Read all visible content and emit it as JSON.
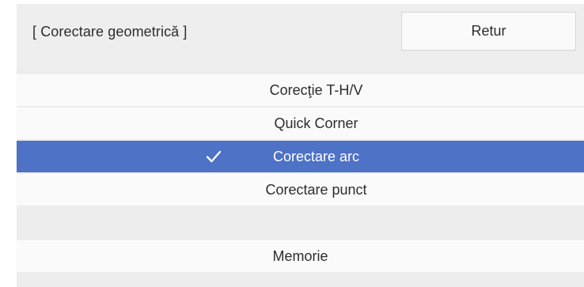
{
  "header": {
    "title": "[ Corectare geometrică ]",
    "return_label": "Retur"
  },
  "menu": {
    "items": [
      {
        "label": "Corecţie T-H/V"
      },
      {
        "label": "Quick Corner"
      },
      {
        "label": "Corectare arc",
        "selected": true
      },
      {
        "label": "Corectare punct"
      }
    ],
    "memory_label": "Memorie"
  },
  "colors": {
    "selection": "#4d72c6",
    "panel_bg": "#ededed",
    "row_bg": "#fafafa"
  },
  "icons": {
    "selected_marker": "checkmark-icon"
  }
}
